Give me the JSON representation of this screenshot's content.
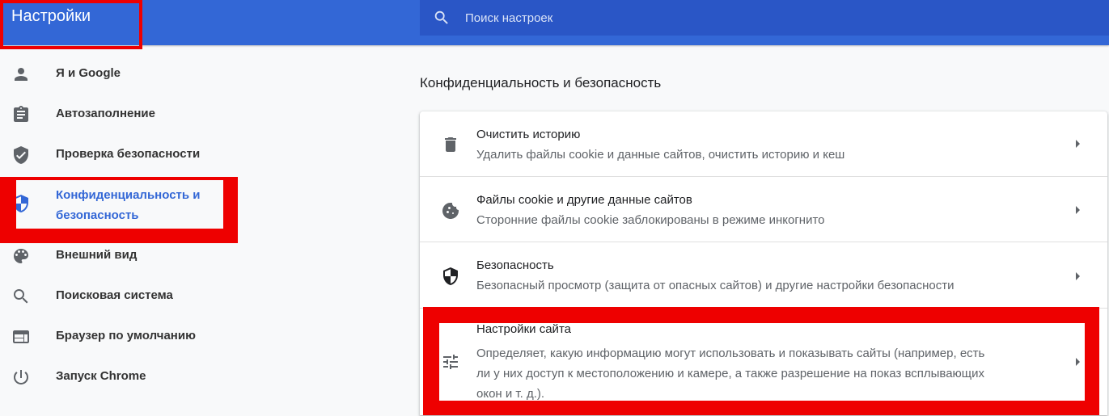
{
  "header": {
    "title": "Настройки",
    "search_placeholder": "Поиск настроек"
  },
  "sidebar": {
    "items": [
      {
        "label": "Я и Google",
        "icon": "person-icon"
      },
      {
        "label": "Автозаполнение",
        "icon": "clipboard-icon"
      },
      {
        "label": "Проверка безопасности",
        "icon": "shield-check-icon"
      },
      {
        "label_line1": "Конфиденциальность и",
        "label_line2": "безопасность",
        "icon": "shield-half-icon",
        "active": true
      },
      {
        "label": "Внешний вид",
        "icon": "palette-icon"
      },
      {
        "label": "Поисковая система",
        "icon": "search-icon"
      },
      {
        "label": "Браузер по умолчанию",
        "icon": "browser-window-icon"
      },
      {
        "label": "Запуск Chrome",
        "icon": "power-icon"
      }
    ]
  },
  "main": {
    "section_title": "Конфиденциальность и безопасность",
    "rows": [
      {
        "title": "Очистить историю",
        "subtitle": "Удалить файлы cookie и данные сайтов, очистить историю и кеш",
        "icon": "trash-icon"
      },
      {
        "title": "Файлы cookie и другие данные сайтов",
        "subtitle": "Сторонние файлы cookie заблокированы в режиме инкогнито",
        "icon": "cookie-icon"
      },
      {
        "title": "Безопасность",
        "subtitle": "Безопасный просмотр (защита от опасных сайтов) и другие настройки безопасности",
        "icon": "shield-half-icon"
      },
      {
        "title": "Настройки сайта",
        "subtitle_line1": "Определяет, какую информацию могут использовать и показывать сайты (например, есть",
        "subtitle_line2": "ли у них доступ к местоположению и камере, а также разрешение на показ всплывающих",
        "subtitle_line3": "окон и т. д.).",
        "icon": "tune-icon"
      }
    ]
  },
  "colors": {
    "header_bg": "#3367d6",
    "search_bg": "#2a56c6",
    "accent": "#3367d6",
    "highlight": "#ee0000"
  }
}
